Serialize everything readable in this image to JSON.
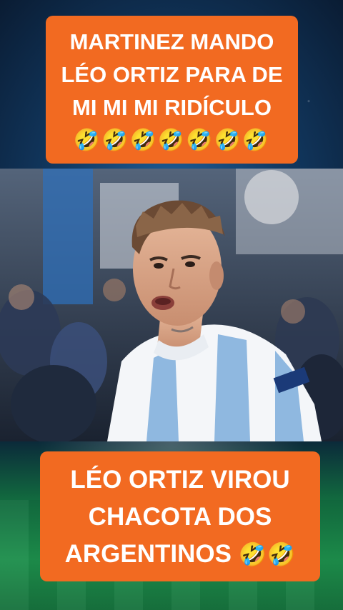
{
  "top_caption": {
    "lines": [
      "MARTINEZ MANDO",
      "LÉO ORTIZ PARA DE",
      "MI MI MI RIDÍCULO"
    ],
    "emojis": "🤣🤣🤣🤣🤣🤣🤣"
  },
  "bottom_caption": {
    "lines": [
      "LÉO ORTIZ VIROU",
      "CHACOTA DOS",
      "ARGENTINOS"
    ],
    "emojis": "🤣🤣"
  },
  "colors": {
    "caption_bg": "#f26a21",
    "caption_text": "#ffffff",
    "jersey_blue": "#8fb8e0"
  }
}
